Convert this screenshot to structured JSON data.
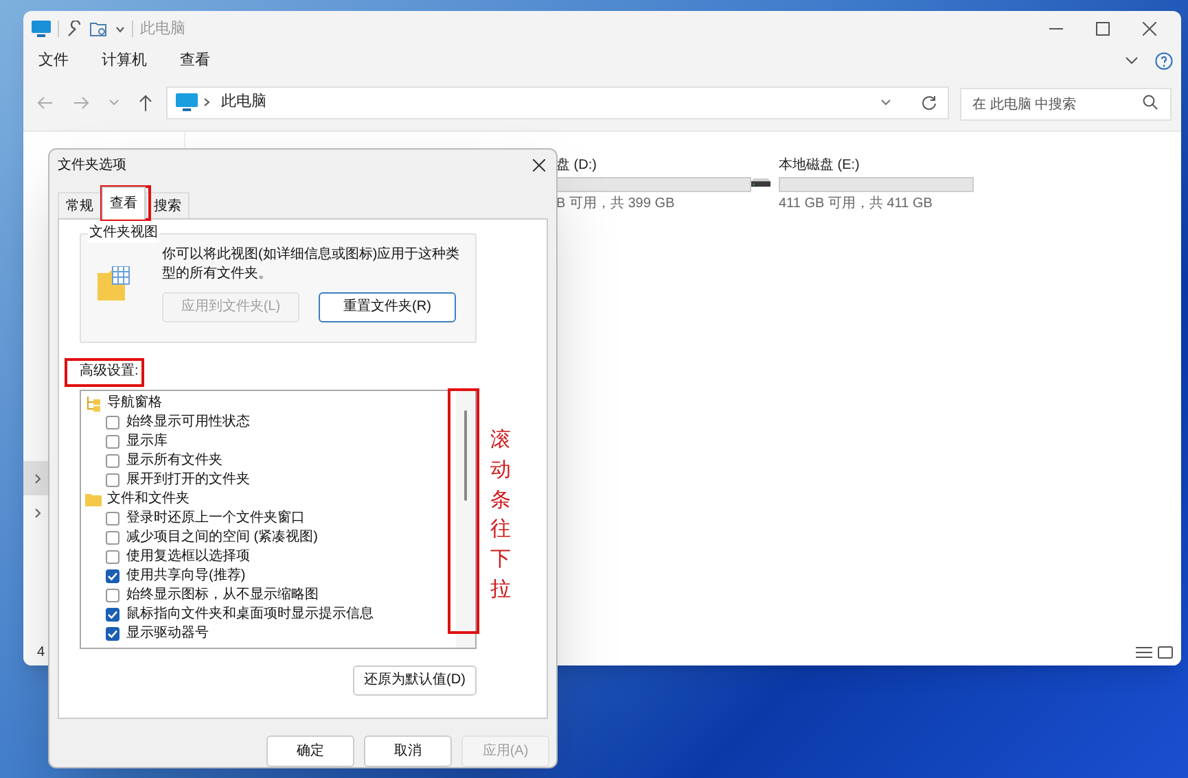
{
  "explorer": {
    "title": "此电脑",
    "menu": [
      "文件",
      "计算机",
      "查看"
    ],
    "address": "此电脑",
    "search": {
      "placeholder": "在 此电脑 中搜索"
    },
    "drives": [
      {
        "name": "盘 (D:)",
        "level": 0.0,
        "info": "B 可用，共 399 GB"
      },
      {
        "name": "本地磁盘 (E:)",
        "level": 0.0,
        "info": "411 GB 可用，共 411 GB"
      }
    ],
    "sidebar_rows": [
      {
        "selected": true
      },
      {
        "selected": false
      }
    ],
    "status_bar": "4"
  },
  "dialog": {
    "title": "文件夹选项",
    "tabs": [
      {
        "label": "常规",
        "selected": false
      },
      {
        "label": "查看",
        "selected": true
      },
      {
        "label": "搜索",
        "selected": false
      }
    ],
    "folder_view": {
      "legend": "文件夹视图",
      "description": "你可以将此视图(如详细信息或图标)应用于这种类型的所有文件夹。",
      "buttons": [
        {
          "label": "应用到文件夹(L)",
          "disabled": true
        },
        {
          "label": "重置文件夹(R)",
          "disabled": false
        }
      ]
    },
    "advanced_label": "高级设置:",
    "tree": [
      {
        "label": "导航窗格",
        "kind": "group",
        "children": [
          {
            "label": "始终显示可用性状态",
            "checked": false
          },
          {
            "label": "显示库",
            "checked": false
          },
          {
            "label": "显示所有文件夹",
            "checked": false
          },
          {
            "label": "展开到打开的文件夹",
            "checked": false
          }
        ]
      },
      {
        "label": "文件和文件夹",
        "kind": "folder",
        "children": [
          {
            "label": "登录时还原上一个文件夹窗口",
            "checked": false
          },
          {
            "label": "减少项目之间的空间 (紧凑视图)",
            "checked": false
          },
          {
            "label": "使用复选框以选择项",
            "checked": false
          },
          {
            "label": "使用共享向导(推荐)",
            "checked": true
          },
          {
            "label": "始终显示图标，从不显示缩略图",
            "checked": false
          },
          {
            "label": "鼠标指向文件夹和桌面项时显示提示信息",
            "checked": true
          },
          {
            "label": "显示驱动器号",
            "checked": true
          }
        ]
      }
    ],
    "restore_button": "还原为默认值(D)",
    "footer_buttons": [
      {
        "label": "确定",
        "disabled": false
      },
      {
        "label": "取消",
        "disabled": false
      },
      {
        "label": "应用(A)",
        "disabled": true
      }
    ]
  },
  "annotation": {
    "text": "滚动条往下拉"
  }
}
